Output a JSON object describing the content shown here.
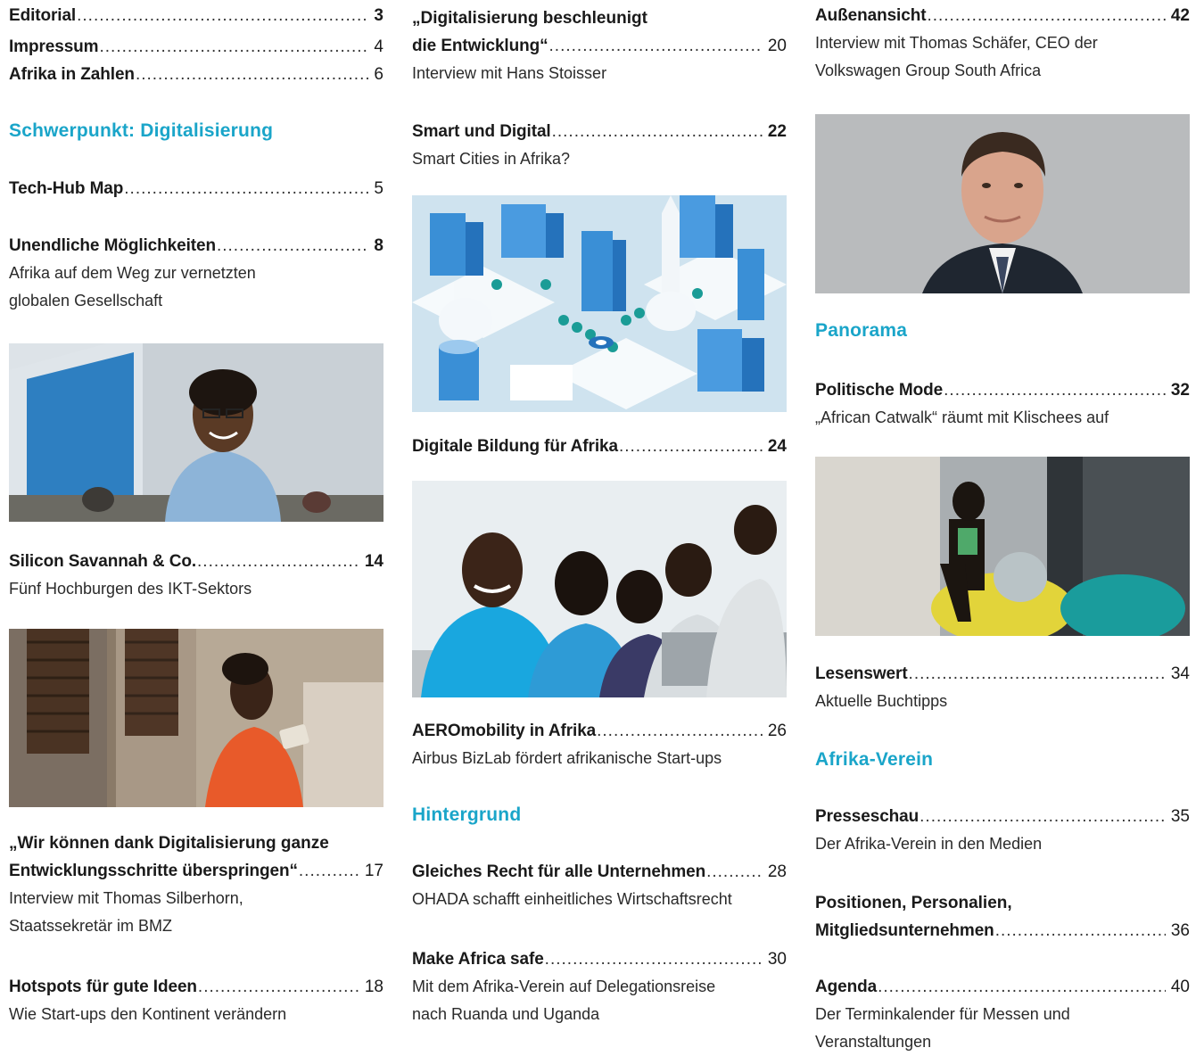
{
  "accent_color": "#1aa5c9",
  "col1": {
    "editorial": {
      "title": "Editorial",
      "page": "3"
    },
    "impressum": {
      "title": "Impressum",
      "page": "4"
    },
    "zahlen": {
      "title": "Afrika in Zahlen",
      "page": "6"
    },
    "section": "Schwerpunkt: Digitalisierung",
    "techhub": {
      "title": "Tech-Hub Map",
      "page": "5"
    },
    "unendliche": {
      "title": "Unendliche Möglichkeiten",
      "page": "8",
      "sub1": "Afrika auf dem Weg zur vernetzten",
      "sub2": "globalen Gesellschaft"
    },
    "silicon": {
      "title": "Silicon Savannah & Co.",
      "page": "14",
      "sub1": "Fünf Hochburgen des IKT-Sektors"
    },
    "wir": {
      "title1": "„Wir können dank Digitalisierung ganze",
      "title2": "Entwicklungsschritte überspringen“",
      "page": "17",
      "sub1": "Interview mit Thomas Silberhorn,",
      "sub2": "Staatssekretär im BMZ"
    },
    "hotspots": {
      "title": "Hotspots für gute Ideen",
      "page": "18",
      "sub1": "Wie Start-ups den Kontinent verändern"
    }
  },
  "col2": {
    "digital": {
      "title1": "„Digitalisierung beschleunigt",
      "title2": "die Entwicklung“",
      "page": "20",
      "sub1": "Interview mit Hans Stoisser"
    },
    "smart": {
      "title": "Smart und Digital",
      "page": "22",
      "sub1": "Smart Cities in Afrika?"
    },
    "bildung": {
      "title": "Digitale Bildung für Afrika",
      "page": "24"
    },
    "aero": {
      "title": "AEROmobility in Afrika",
      "page": "26",
      "sub1": "Airbus BizLab fördert afrikanische Start-ups"
    },
    "section": "Hintergrund",
    "gleiches": {
      "title": "Gleiches Recht für alle Unternehmen",
      "page": "28",
      "sub1": "OHADA schafft einheitliches Wirtschaftsrecht"
    },
    "safe": {
      "title": "Make Africa safe",
      "page": "30",
      "sub1": "Mit dem Afrika-Verein auf Delegationsreise",
      "sub2": "nach Ruanda und Uganda"
    }
  },
  "col3": {
    "aussen": {
      "title": "Außenansicht",
      "page": "42",
      "sub1": "Interview mit Thomas Schäfer, CEO der",
      "sub2": "Volkswagen Group South Africa"
    },
    "section1": "Panorama",
    "mode": {
      "title": "Politische Mode",
      "page": "32",
      "sub1": "„African Catwalk“ räumt mit Klischees auf"
    },
    "lesenswert": {
      "title": "Lesenswert",
      "page": "34",
      "sub1": "Aktuelle Buchtipps"
    },
    "section2": "Afrika-Verein",
    "presse": {
      "title": "Presseschau",
      "page": "35",
      "sub1": "Der Afrika-Verein in den Medien"
    },
    "positionen": {
      "title1": "Positionen, Personalien,",
      "title2": "Mitgliedsunternehmen",
      "page": "36"
    },
    "agenda": {
      "title": "Agenda",
      "page": "40",
      "sub1": "Der Terminkalender für Messen und",
      "sub2": "Veranstaltungen"
    }
  }
}
